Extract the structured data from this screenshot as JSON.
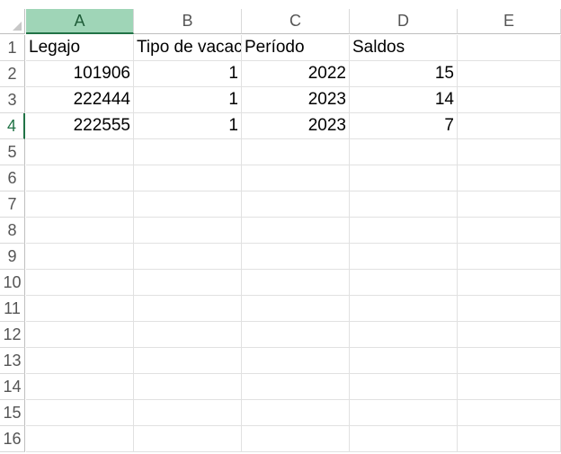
{
  "columns": [
    "A",
    "B",
    "C",
    "D",
    "E"
  ],
  "rows": [
    "1",
    "2",
    "3",
    "4",
    "5",
    "6",
    "7",
    "8",
    "9",
    "10",
    "11",
    "12",
    "13",
    "14",
    "15",
    "16"
  ],
  "selected_column": "A",
  "selected_row": "4",
  "cells": [
    [
      "Legajo",
      "Tipo de vacac",
      "Período",
      "Saldos",
      ""
    ],
    [
      "101906",
      "1",
      "2022",
      "15",
      ""
    ],
    [
      "222444",
      "1",
      "2023",
      "14",
      ""
    ],
    [
      "222555",
      "1",
      "2023",
      "7",
      ""
    ]
  ],
  "colors": {
    "selected_header_bg": "#9fd5b7",
    "accent": "#217346"
  }
}
